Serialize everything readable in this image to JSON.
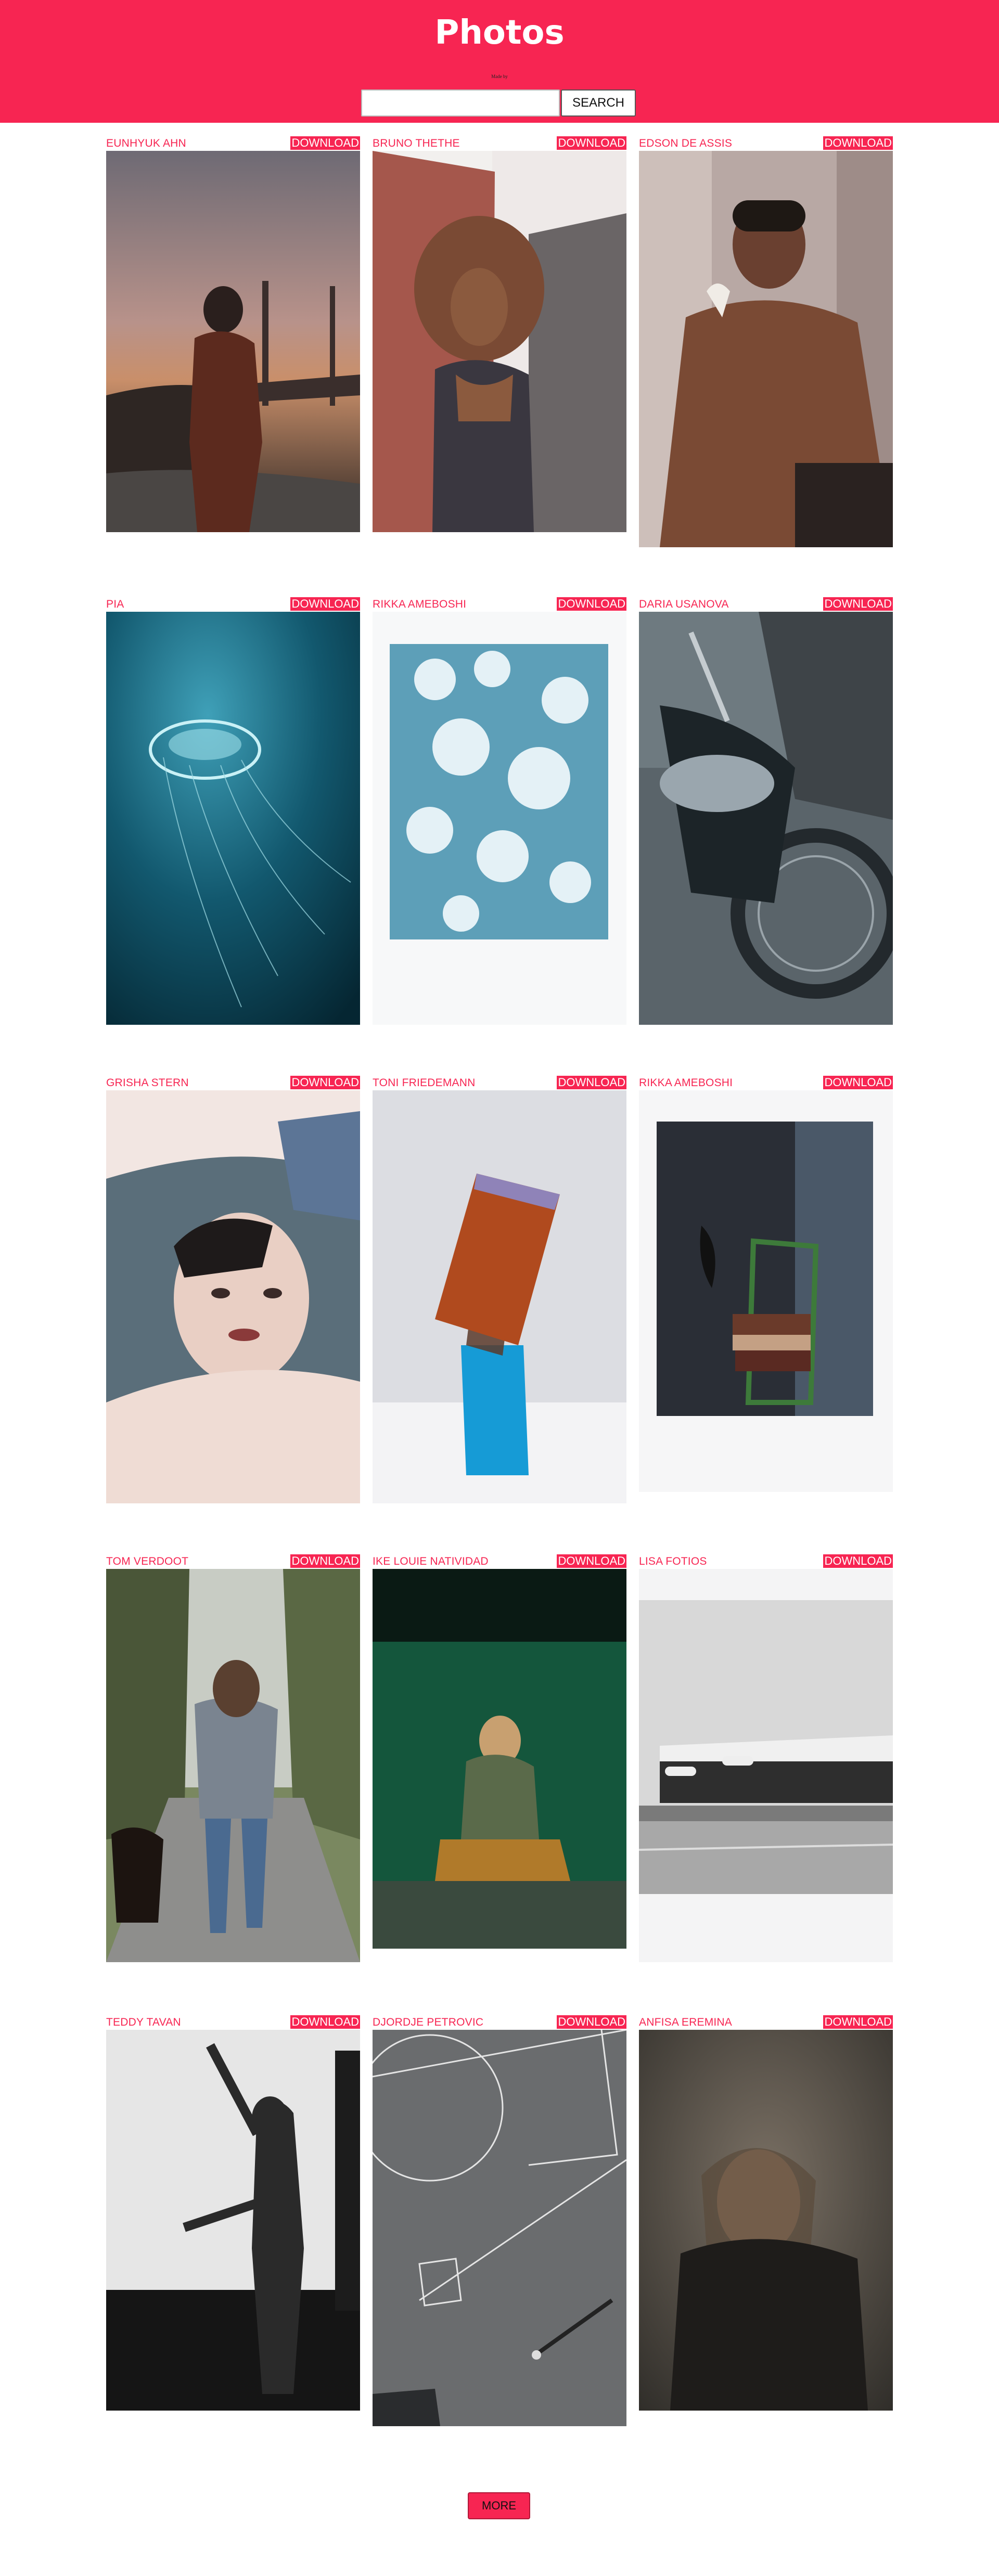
{
  "header": {
    "title": "Photos",
    "made_by": "Made by",
    "search_placeholder": "",
    "search_button": "SEARCH"
  },
  "download_label": "DOWNLOAD",
  "more_label": "MORE",
  "colors": {
    "accent": "#f72552"
  },
  "photos": [
    {
      "author": "EUNHYUK AHN",
      "subject": "person by golden gate bridge at sunset"
    },
    {
      "author": "BRUNO THETHE",
      "subject": "woman with curly hair portrait"
    },
    {
      "author": "EDSON DE ASSIS",
      "subject": "man portrait with flower"
    },
    {
      "author": "PIA",
      "subject": "jellyfish underwater"
    },
    {
      "author": "RIKKA AMEBOSHI",
      "subject": "cyanotype flowers print"
    },
    {
      "author": "DARIA USANOVA",
      "subject": "motorcycle and rider"
    },
    {
      "author": "GRISHA STERN",
      "subject": "woman face portrait with hands"
    },
    {
      "author": "TONI FRIEDEMANN",
      "subject": "glass blocks sculpture"
    },
    {
      "author": "RIKKA AMEBOSHI",
      "subject": "polaroid of chair with books"
    },
    {
      "author": "TOM VERDOOT",
      "subject": "man walking dog on path"
    },
    {
      "author": "IKE LOUIE NATIVIDAD",
      "subject": "woman crouching by green wall"
    },
    {
      "author": "LISA FOTIOS",
      "subject": "black and white storefront"
    },
    {
      "author": "TEDDY TAVAN",
      "subject": "dancer silhouette black and white"
    },
    {
      "author": "DJORDJE PETROVIC",
      "subject": "aerial basketball court"
    },
    {
      "author": "ANFISA EREMINA",
      "subject": "person behind wet glass"
    }
  ]
}
